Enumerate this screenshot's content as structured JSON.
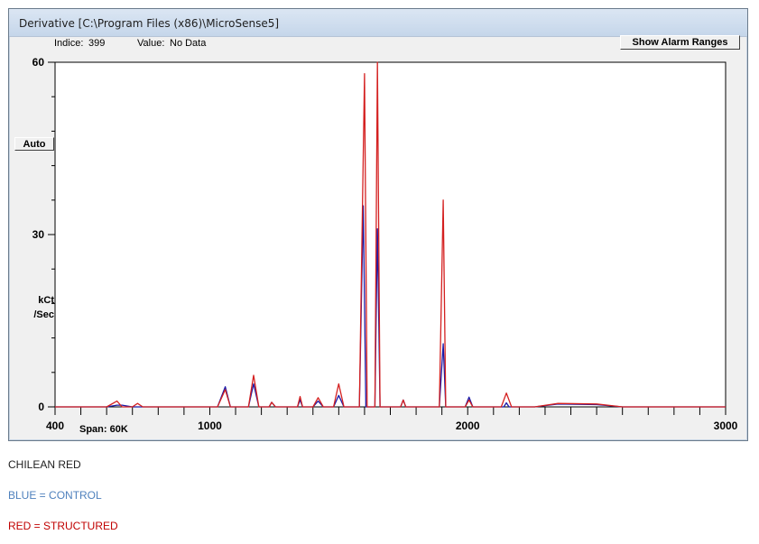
{
  "window": {
    "title": "Derivative [C:\\Program Files (x86)\\MicroSense5]",
    "indice_label": "Indice:",
    "indice_value": "399",
    "value_label": "Value:",
    "value_value": "No Data",
    "show_alarm_button": "Show Alarm Ranges",
    "auto_button": "Auto",
    "span_label": "Span: 60K"
  },
  "legend": {
    "title": "CHILEAN RED",
    "blue_label": "BLUE = CONTROL",
    "red_label": "RED = STRUCTURED"
  },
  "colors": {
    "blue": "#1a1aa8",
    "red": "#d42020",
    "blue_text": "#4f81bd",
    "red_text": "#c00000"
  },
  "chart_data": {
    "type": "line",
    "title": "",
    "xlabel": "",
    "ylabel": "kCt /Sec",
    "ylabel_lines": [
      "kCt",
      "/Sec"
    ],
    "xlim": [
      400,
      3000
    ],
    "ylim": [
      0,
      60
    ],
    "x_tick_labels": [
      "400",
      "1000",
      "2000",
      "3000"
    ],
    "x_tick_values": [
      400,
      1000,
      2000,
      3000
    ],
    "y_tick_labels": [
      "0",
      "30",
      "60"
    ],
    "y_tick_values": [
      0,
      30,
      60
    ],
    "grid": false,
    "series": [
      {
        "name": "CONTROL",
        "color": "#1a1aa8",
        "points": [
          [
            400,
            0
          ],
          [
            600,
            0
          ],
          [
            640,
            0.3
          ],
          [
            660,
            0.3
          ],
          [
            700,
            0
          ],
          [
            1030,
            0
          ],
          [
            1060,
            3.5
          ],
          [
            1080,
            0
          ],
          [
            1150,
            0
          ],
          [
            1170,
            4
          ],
          [
            1190,
            0
          ],
          [
            1230,
            0
          ],
          [
            1240,
            0.8
          ],
          [
            1255,
            0
          ],
          [
            1340,
            0
          ],
          [
            1350,
            1.2
          ],
          [
            1360,
            0
          ],
          [
            1400,
            0
          ],
          [
            1420,
            1
          ],
          [
            1440,
            0
          ],
          [
            1480,
            0
          ],
          [
            1500,
            2
          ],
          [
            1520,
            0
          ],
          [
            1580,
            0
          ],
          [
            1595,
            35
          ],
          [
            1605,
            0
          ],
          [
            1640,
            0
          ],
          [
            1650,
            31
          ],
          [
            1660,
            0
          ],
          [
            1740,
            0
          ],
          [
            1750,
            1.2
          ],
          [
            1760,
            0
          ],
          [
            1890,
            0
          ],
          [
            1905,
            11
          ],
          [
            1915,
            0
          ],
          [
            1990,
            0
          ],
          [
            2005,
            1.7
          ],
          [
            2020,
            0
          ],
          [
            2140,
            0
          ],
          [
            2150,
            0.7
          ],
          [
            2160,
            0
          ],
          [
            2260,
            0
          ],
          [
            2350,
            0.5
          ],
          [
            2500,
            0.4
          ],
          [
            2600,
            0
          ],
          [
            3000,
            0
          ]
        ]
      },
      {
        "name": "STRUCTURED",
        "color": "#d42020",
        "points": [
          [
            400,
            0
          ],
          [
            600,
            0
          ],
          [
            640,
            1
          ],
          [
            660,
            0
          ],
          [
            700,
            0
          ],
          [
            720,
            0.6
          ],
          [
            740,
            0
          ],
          [
            1030,
            0
          ],
          [
            1060,
            3
          ],
          [
            1080,
            0
          ],
          [
            1150,
            0
          ],
          [
            1170,
            5.5
          ],
          [
            1190,
            0
          ],
          [
            1230,
            0
          ],
          [
            1240,
            0.8
          ],
          [
            1255,
            0
          ],
          [
            1340,
            0
          ],
          [
            1350,
            1.8
          ],
          [
            1360,
            0
          ],
          [
            1400,
            0
          ],
          [
            1420,
            1.6
          ],
          [
            1440,
            0
          ],
          [
            1480,
            0
          ],
          [
            1500,
            4
          ],
          [
            1520,
            0
          ],
          [
            1580,
            0
          ],
          [
            1600,
            58
          ],
          [
            1610,
            0
          ],
          [
            1640,
            0
          ],
          [
            1650,
            60
          ],
          [
            1660,
            0
          ],
          [
            1740,
            0
          ],
          [
            1750,
            1.2
          ],
          [
            1760,
            0
          ],
          [
            1890,
            0
          ],
          [
            1905,
            36
          ],
          [
            1915,
            0
          ],
          [
            1990,
            0
          ],
          [
            2005,
            1.2
          ],
          [
            2020,
            0
          ],
          [
            2130,
            0
          ],
          [
            2150,
            2.4
          ],
          [
            2170,
            0
          ],
          [
            2260,
            0
          ],
          [
            2350,
            0.6
          ],
          [
            2500,
            0.5
          ],
          [
            2600,
            0
          ],
          [
            3000,
            0
          ]
        ]
      }
    ]
  }
}
